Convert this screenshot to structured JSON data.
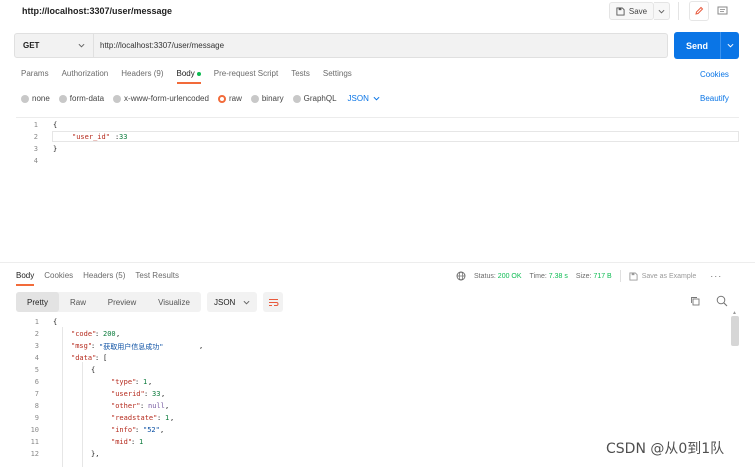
{
  "header": {
    "title": "http://localhost:3307/user/message",
    "save_label": "Save"
  },
  "request": {
    "method": "GET",
    "url": "http://localhost:3307/user/message",
    "send_label": "Send",
    "tabs": [
      "Params",
      "Authorization",
      "Headers (9)",
      "Body",
      "Pre-request Script",
      "Tests",
      "Settings"
    ],
    "active_tab": "Body",
    "cookies_label": "Cookies",
    "body_types": [
      "none",
      "form-data",
      "x-www-form-urlencoded",
      "raw",
      "binary",
      "GraphQL"
    ],
    "selected_body_type": "raw",
    "format": "JSON",
    "beautify_label": "Beautify",
    "editor_lines": [
      "1",
      "2",
      "3",
      "4"
    ],
    "body_open": "{",
    "body_key": "\"user_id\"",
    "body_colon": ":",
    "body_value": "33",
    "body_close": "}"
  },
  "response": {
    "tabs": [
      "Body",
      "Cookies",
      "Headers (5)",
      "Test Results"
    ],
    "active_tab": "Body",
    "status_label": "Status:",
    "status_value": "200 OK",
    "time_label": "Time:",
    "time_value": "7.38 s",
    "size_label": "Size:",
    "size_value": "717 B",
    "save_example_label": "Save as Example",
    "view_modes": [
      "Pretty",
      "Raw",
      "Preview",
      "Visualize"
    ],
    "active_view": "Pretty",
    "format": "JSON",
    "line_numbers": [
      "1",
      "2",
      "3",
      "4",
      "5",
      "6",
      "7",
      "8",
      "9",
      "10",
      "11",
      "12"
    ],
    "json": {
      "l1": "{",
      "code_key": "\"code\"",
      "code_val": "200",
      "msg_key": "\"msg\"",
      "msg_val": "\"获取用户信息成功\"",
      "data_key": "\"data\"",
      "data_open": "[",
      "obj_open": "{",
      "type_key": "\"type\"",
      "type_val": "1",
      "userid_key": "\"userid\"",
      "userid_val": "33",
      "other_key": "\"other\"",
      "other_val": "null",
      "readstate_key": "\"readstate\"",
      "readstate_val": "1",
      "info_key": "\"info\"",
      "info_val": "\"52\"",
      "mid_key": "\"mid\"",
      "mid_val": "1",
      "obj_close": "},"
    }
  },
  "watermark": "CSDN @从0到1队",
  "colors": {
    "accent": "#f26b3a",
    "send": "#0a75e6",
    "status_ok": "#0cbb52"
  }
}
